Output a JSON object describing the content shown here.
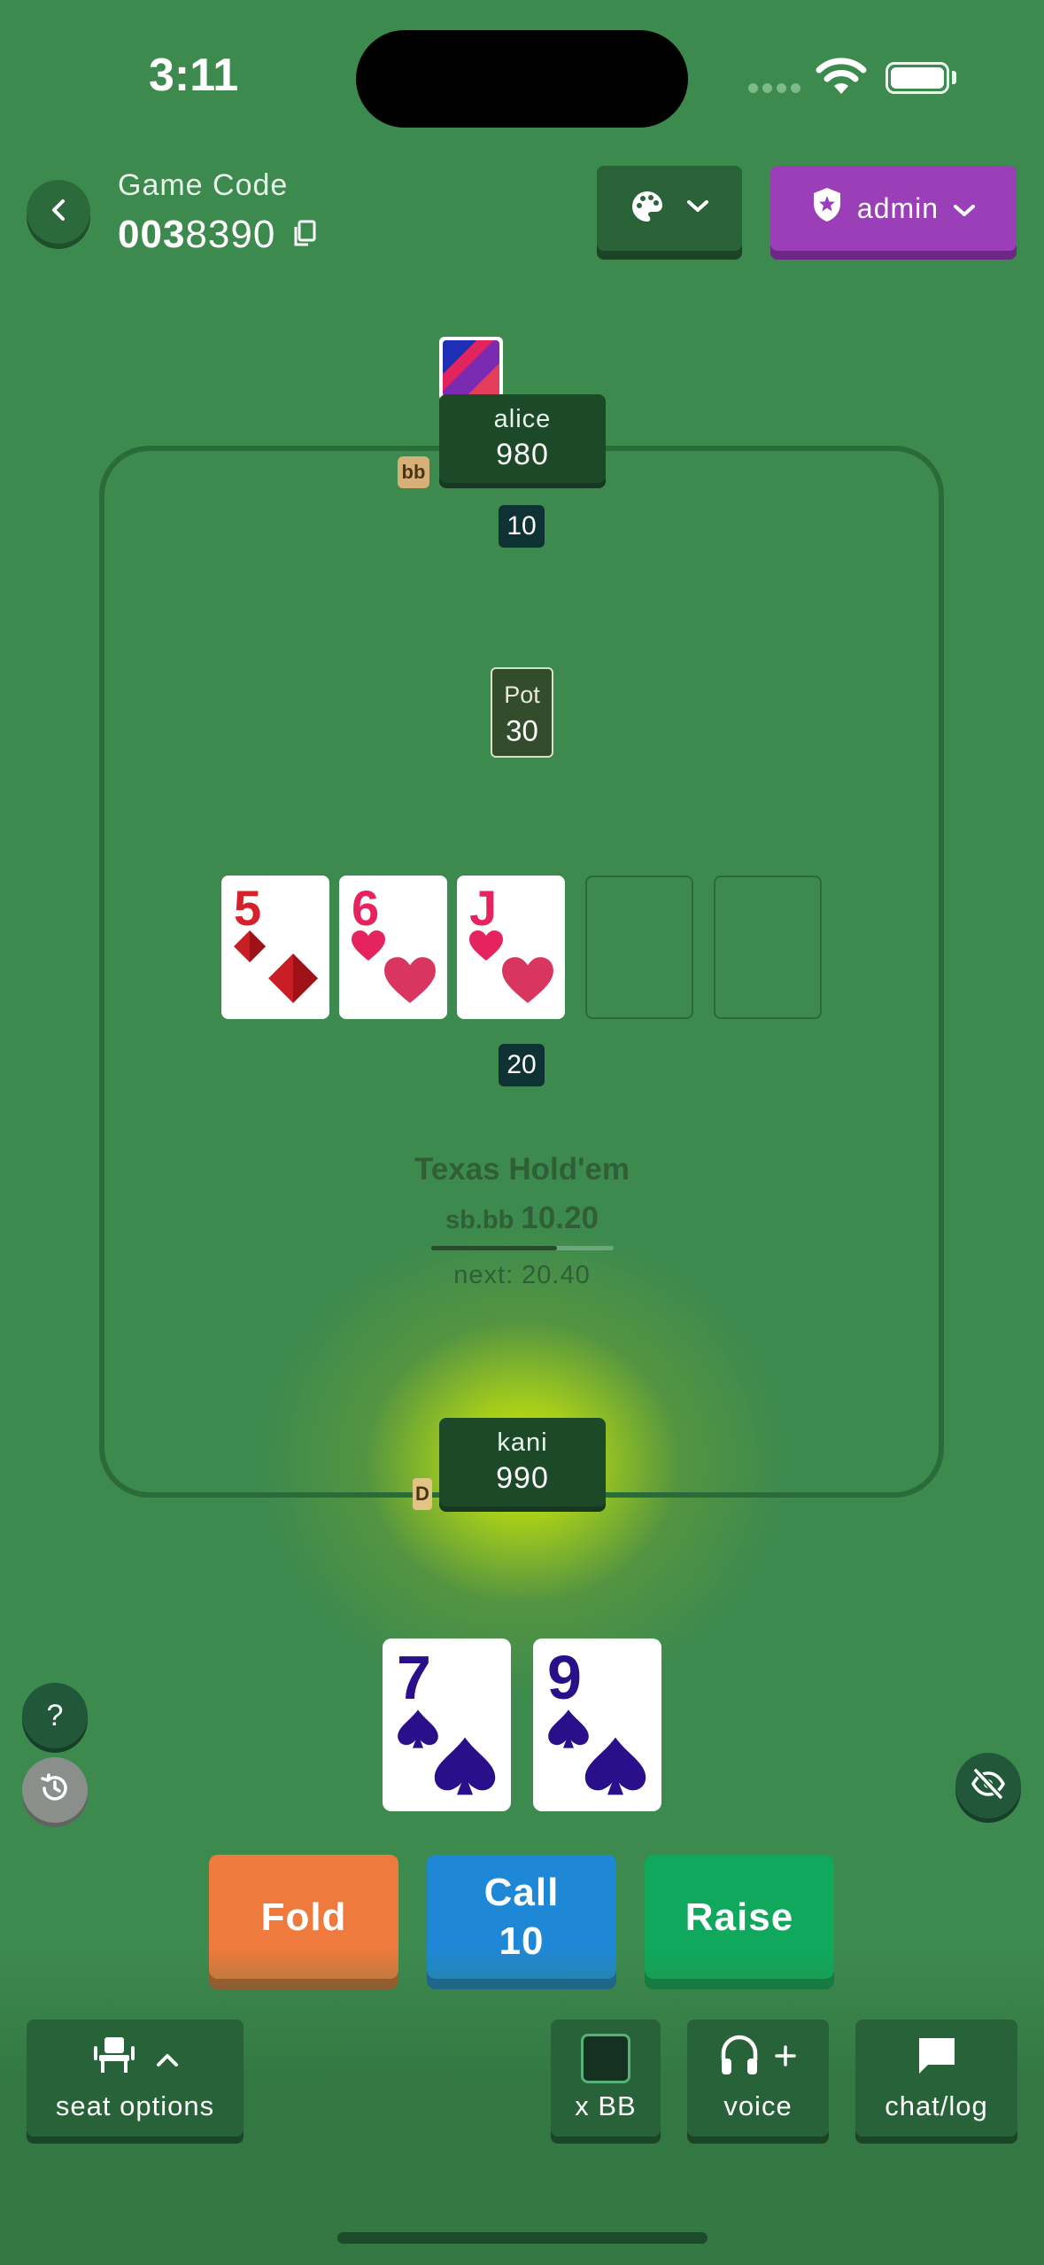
{
  "status_bar": {
    "time": "3:11"
  },
  "header": {
    "game_code_label": "Game Code",
    "game_code_bold": "003",
    "game_code_rest": "8390",
    "theme_button_icon": "palette-icon",
    "admin_label": "admin",
    "admin_icon": "shield-star-icon",
    "colors": {
      "admin": "#9b3fb9",
      "theme": "#2a6337"
    }
  },
  "players": {
    "top": {
      "name": "alice",
      "stack": "980",
      "bet": "10",
      "position_badge": "bb"
    },
    "bottom": {
      "name": "kani",
      "stack": "990",
      "bet": "20",
      "position_badge": "D"
    }
  },
  "pot": {
    "label": "Pot",
    "value": "30"
  },
  "board": {
    "cards": [
      {
        "rank": "5",
        "suit": "diamonds",
        "color": "#d4212a"
      },
      {
        "rank": "6",
        "suit": "hearts",
        "color": "#e5235e"
      },
      {
        "rank": "J",
        "suit": "hearts",
        "color": "#e5235e"
      }
    ],
    "empty_slots": 2
  },
  "game_info": {
    "name": "Texas Hold'em",
    "blinds_label": "sb.bb",
    "blinds_value": "10.20",
    "blind_timer_progress": 0.69,
    "next_blinds": "next: 20.40"
  },
  "hole_cards": [
    {
      "rank": "7",
      "suit": "spades",
      "color": "#2a0f8a"
    },
    {
      "rank": "9",
      "suit": "spades",
      "color": "#2a0f8a"
    }
  ],
  "actions": {
    "fold": "Fold",
    "call_label": "Call",
    "call_amount": "10",
    "raise": "Raise",
    "colors": {
      "fold": "#ee7a3d",
      "call": "#1f88d6",
      "raise": "#10a85c"
    }
  },
  "side_buttons": {
    "help": "?",
    "history_icon": "history-icon",
    "hide_icon": "eye-off-icon"
  },
  "bottom_bar": {
    "seat_options": "seat options",
    "xbb": "x BB",
    "voice": "voice",
    "chat": "chat/log"
  },
  "table_color": "#3d8a4e"
}
